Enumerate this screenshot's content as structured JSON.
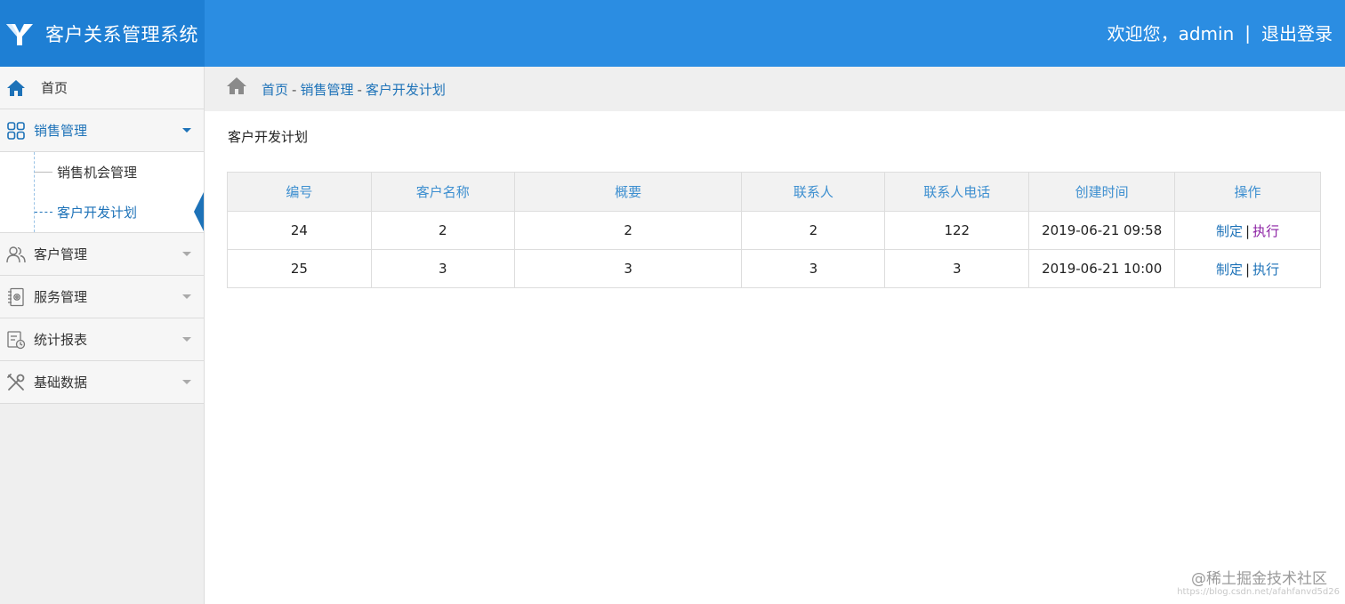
{
  "header": {
    "title": "客户关系管理系统",
    "welcome": "欢迎您，admin",
    "separator": "|",
    "logout": "退出登录",
    "color": "#2b8de2"
  },
  "sidebar": {
    "items": [
      {
        "label": "首页",
        "icon": "home-icon"
      },
      {
        "label": "销售管理",
        "icon": "grid-icon",
        "expanded": true,
        "children": [
          {
            "label": "销售机会管理"
          },
          {
            "label": "客户开发计划",
            "active": true
          }
        ]
      },
      {
        "label": "客户管理",
        "icon": "users-icon"
      },
      {
        "label": "服务管理",
        "icon": "contacts-book-icon"
      },
      {
        "label": "统计报表",
        "icon": "report-icon"
      },
      {
        "label": "基础数据",
        "icon": "tools-icon"
      }
    ]
  },
  "breadcrumb": {
    "items": [
      "首页",
      "销售管理",
      "客户开发计划"
    ],
    "separator": "-"
  },
  "main": {
    "title": "客户开发计划",
    "table": {
      "headers": [
        "编号",
        "客户名称",
        "概要",
        "联系人",
        "联系人电话",
        "创建时间",
        "操作"
      ],
      "rows": [
        {
          "id": "24",
          "name": "2",
          "summary": "2",
          "contact": "2",
          "phone": "122",
          "created": "2019-06-21 09:58",
          "op_make": "制定",
          "op_sep": "|",
          "op_run": "执行"
        },
        {
          "id": "25",
          "name": "3",
          "summary": "3",
          "contact": "3",
          "phone": "3",
          "created": "2019-06-21 10:00",
          "op_make": "制定",
          "op_sep": "|",
          "op_run": "执行"
        }
      ]
    }
  },
  "watermark": {
    "text": "@稀土掘金技术社区",
    "url": "https://blog.csdn.net/afahfanvd5d26"
  }
}
